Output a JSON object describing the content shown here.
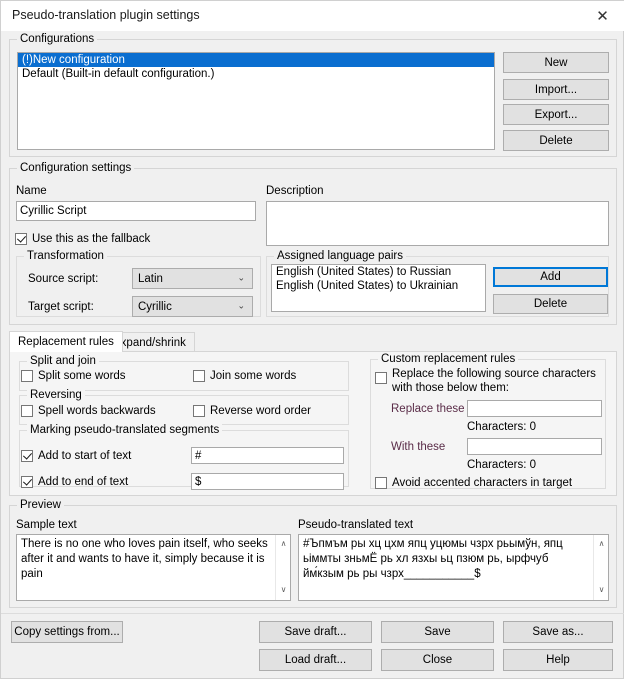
{
  "window": {
    "title": "Pseudo-translation plugin settings",
    "close_icon": "close-icon",
    "close_glyph": "✕"
  },
  "configurations": {
    "legend": "Configurations",
    "items": [
      {
        "label": "(!)New configuration",
        "selected": true
      },
      {
        "label": "Default    (Built-in default configuration.)",
        "selected": false
      }
    ],
    "buttons": [
      {
        "label": "New"
      },
      {
        "label": "Import..."
      },
      {
        "label": "Export..."
      },
      {
        "label": "Delete"
      }
    ]
  },
  "configuration_settings": {
    "legend": "Configuration settings",
    "name_label": "Name",
    "name_value": "Cyrillic Script",
    "name_placeholder": "",
    "description_label": "Description",
    "description_value": "",
    "fallback_checkbox": {
      "label": "Use this as the fallback",
      "checked": true
    },
    "transformation": {
      "legend": "Transformation",
      "source_label": "Source script:",
      "source_value": "Latin",
      "target_label": "Target script:",
      "target_value": "Cyrillic",
      "arrow_glyph": "⌄"
    },
    "language_pairs": {
      "legend": "Assigned language pairs",
      "items": [
        "English (United States) to Russian",
        "English (United States) to Ukrainian"
      ],
      "add_label": "Add",
      "delete_label": "Delete"
    }
  },
  "tabs": [
    {
      "label": "Replacement rules",
      "active": true
    },
    {
      "label": "Expand/shrink",
      "active": false
    }
  ],
  "replacement_rules": {
    "split_and_join": {
      "legend": "Split and join",
      "split_words": {
        "label": "Split some words",
        "checked": false
      },
      "join_words": {
        "label": "Join some words",
        "checked": false
      }
    },
    "reversing": {
      "legend": "Reversing",
      "spell_backwards": {
        "label": "Spell words backwards",
        "checked": false
      },
      "reverse_order": {
        "label": "Reverse word order",
        "checked": false
      }
    },
    "marking": {
      "legend": "Marking pseudo-translated segments",
      "add_start": {
        "label": "Add to start of text",
        "checked": true,
        "value": "#"
      },
      "add_end": {
        "label": "Add to end of text",
        "checked": true,
        "value": "$"
      }
    },
    "custom": {
      "legend": "Custom replacement rules",
      "replace_checkbox": {
        "label": "Replace the following source characters with those below them:",
        "checked": false
      },
      "replace_these_label": "Replace these",
      "replace_these_value": "",
      "replace_these_count": "Characters: 0",
      "with_these_label": "With these",
      "with_these_value": "",
      "with_these_count": "Characters: 0",
      "avoid_accented": {
        "label": "Avoid accented characters in target",
        "checked": false
      }
    }
  },
  "preview": {
    "legend": "Preview",
    "sample_label": "Sample text",
    "sample_text": "There is no one who loves pain itself, who seeks after it and wants to have it, simply because it is pain",
    "pseudo_label": "Pseudo-translated text",
    "pseudo_text": "#Ъпмъм ры хц цхм япц уцюмы чзрх рьымўн, япц ьіммты зньмЁ рь хл язхы ьц пзюм рь, ырфчуб йм́кзым рь ры чзрх___________$",
    "scroll_up_glyph": "∧",
    "scroll_down_glyph": "∨"
  },
  "footer": {
    "copy_settings": "Copy settings from...",
    "save_draft": "Save draft...",
    "save": "Save",
    "save_as": "Save as...",
    "load_draft": "Load draft...",
    "close": "Close",
    "help": "Help"
  },
  "colors": {
    "accent": "#0a6ed0",
    "focus": "#0078d7",
    "label_purple": "#5a2c48",
    "window_bg": "#f0f0f0"
  }
}
